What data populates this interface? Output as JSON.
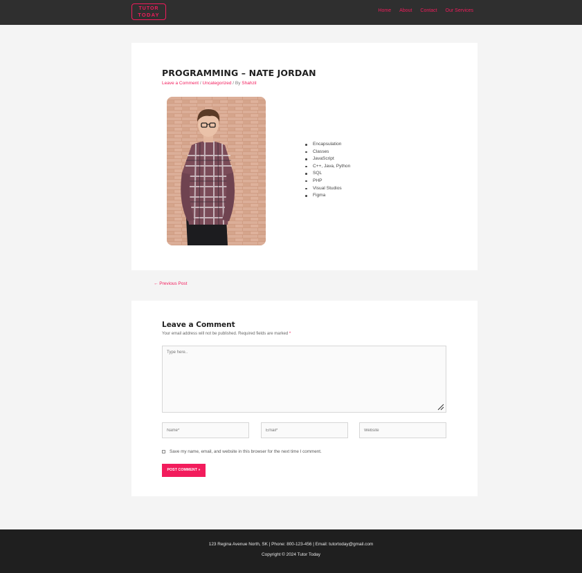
{
  "header": {
    "logo_line1": "TUTOR",
    "logo_line2": "TODAY",
    "nav": [
      "Home",
      "About",
      "Contact",
      "Our Services"
    ]
  },
  "colors": {
    "accent": "#f21c5c",
    "header_bg": "#2f2f2f",
    "footer_bg": "#1f1f1f",
    "page_bg": "#f4f4f4"
  },
  "post": {
    "title": "PROGRAMMING – NATE JORDAN",
    "meta_comment": "Leave a Comment",
    "meta_sep1": " / ",
    "meta_category": "Uncategorized",
    "meta_sep2": " / By ",
    "meta_author": "Shahzil",
    "photo_icon": "portrait-photo",
    "skills": [
      "Encapsulation",
      "Classes",
      "JavaScript",
      "C++, Java, Python",
      "SQL",
      "PHP",
      "Visual Studios",
      "Figma"
    ]
  },
  "navigation": {
    "previous": "← Previous Post"
  },
  "comment_form": {
    "title": "Leave a Comment",
    "note": "Your email address will not be published. Required fields are marked ",
    "required_mark": "*",
    "textarea_placeholder": "Type here..",
    "name_placeholder": "Name*",
    "email_placeholder": "Email*",
    "website_placeholder": "Website",
    "save_label": "Save my name, email, and website in this browser for the next time I comment.",
    "submit_label": "POST COMMENT »"
  },
  "footer": {
    "contact": "123 Regina Avenue North, SK | Phone: 800-123-456 | Email: tutortoday@gmail.com",
    "copyright": "Copyright © 2024 Tutor Today"
  }
}
